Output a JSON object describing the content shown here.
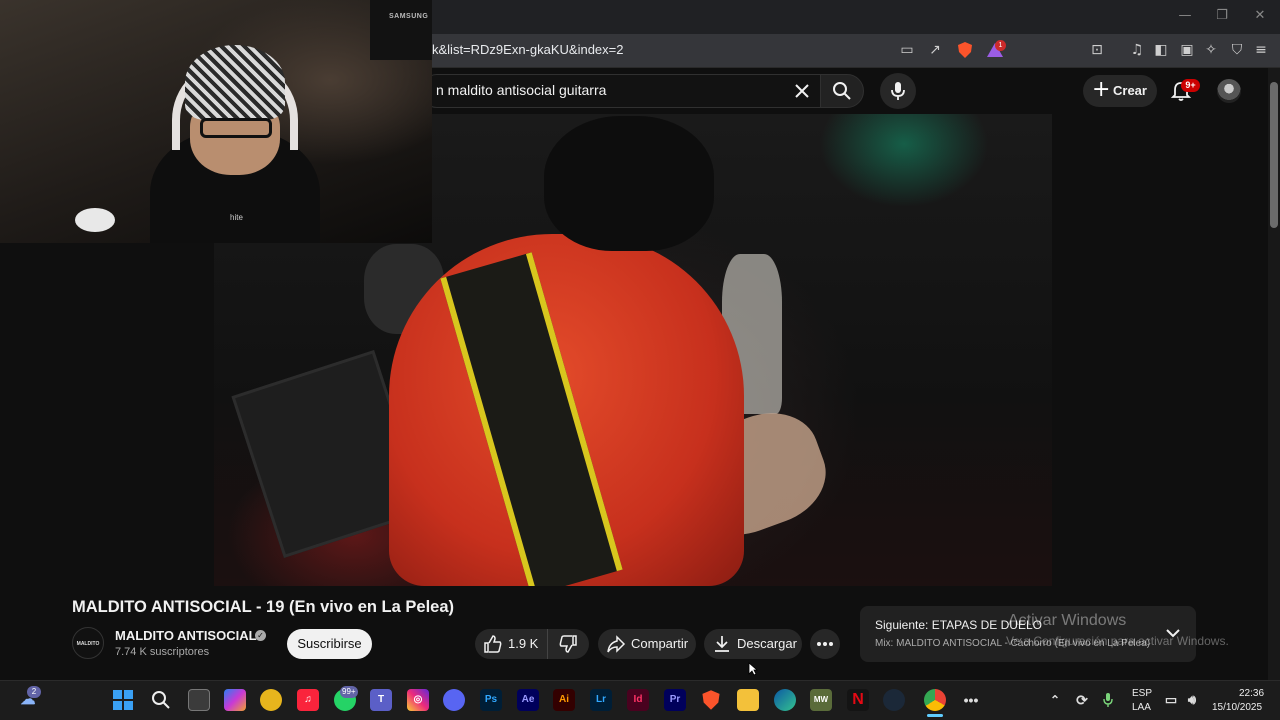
{
  "browser": {
    "url": "k&list=RDz9Exn-gkaKU&index=2",
    "extension_badge": "1"
  },
  "header": {
    "search_query": "n maldito antisocial guitarra",
    "create_label": "Crear",
    "notifications_badge": "9+"
  },
  "webcam": {
    "monitor_label": "SAMSUNG",
    "shirt_text": "hite"
  },
  "video": {
    "title": "MALDITO ANTISOCIAL - 19 (En vivo en La Pelea)",
    "channel_name": "MALDITO ANTISOCIAL",
    "channel_avatar_text": "MALDITO ANTISOCIAL",
    "subscribers": "7.74 K suscriptores",
    "subscribe_label": "Suscribirse",
    "likes": "1.9 K",
    "share_label": "Compartir",
    "download_label": "Descargar"
  },
  "next_up": {
    "title": "Siguiente: ETAPAS DE DUELO",
    "subtitle": "Mix: MALDITO ANTISOCIAL - Cáchorro (En vivo en La Pelea)"
  },
  "watermark": {
    "title": "Activar Windows",
    "subtitle": "Ve a Configuración para activar Windows."
  },
  "taskbar": {
    "widgets_badge": "2",
    "whatsapp_badge": "99+",
    "apps": {
      "ps": "Ps",
      "ae": "Ae",
      "ai": "Ai",
      "lr": "Lr",
      "id": "Id",
      "pr": "Pr",
      "mw": "MW"
    },
    "lang_line1": "ESP",
    "lang_line2": "LAA",
    "time": "22:36",
    "date": "15/10/2025"
  },
  "colors": {
    "youtube_bg": "#0f0f0f",
    "notification_red": "#cc0000",
    "taskbar_bg": "#1c1c1c"
  }
}
